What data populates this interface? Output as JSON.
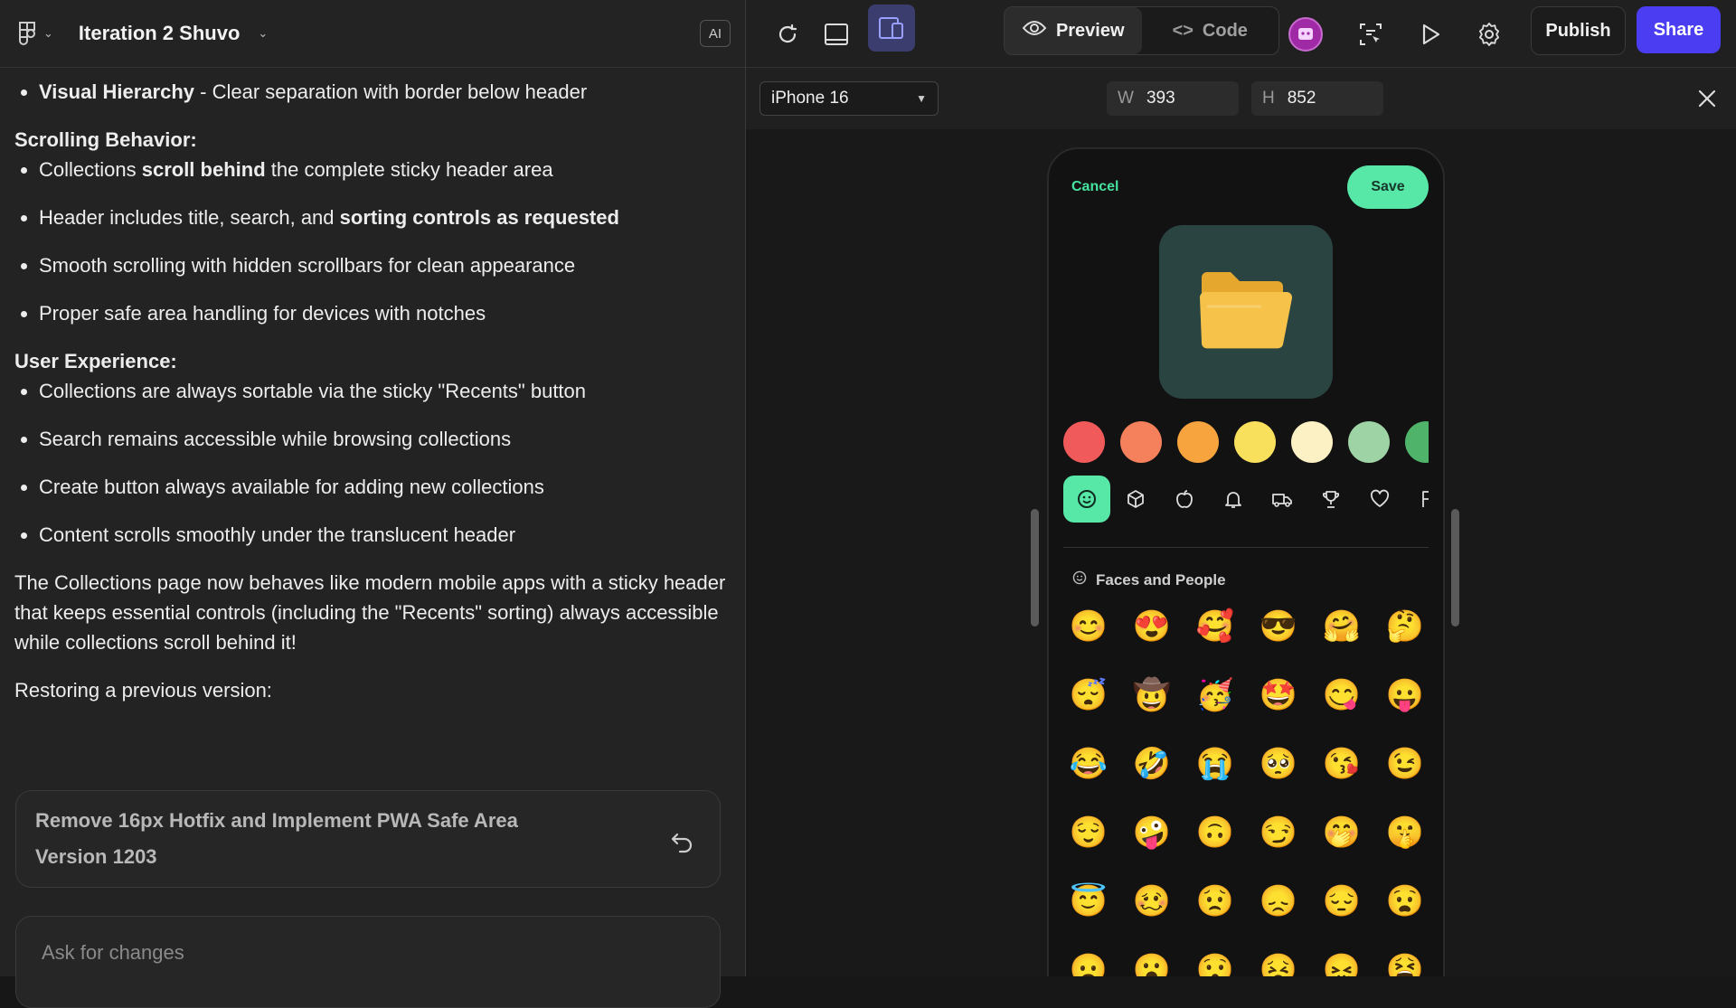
{
  "left": {
    "project_title": "Iteration 2 Shuvo",
    "ai_badge": "AI",
    "b1_title": "Visual Hierarchy",
    "b1_rest": " - Clear separation with border below header",
    "scroll_heading": "Scrolling Behavior:",
    "scroll_b1_pre": "Collections ",
    "scroll_b1_bold": "scroll behind",
    "scroll_b1_post": " the complete sticky header area",
    "scroll_b2_pre": "Header includes title, search, and ",
    "scroll_b2_bold": "sorting controls as requested",
    "scroll_b3": "Smooth scrolling with hidden scrollbars for clean appearance",
    "scroll_b4": "Proper safe area handling for devices with notches",
    "ux_heading": "User Experience:",
    "ux_b1": "Collections are always sortable via the sticky \"Recents\" button",
    "ux_b2": "Search remains accessible while browsing collections",
    "ux_b3": "Create button always available for adding new collections",
    "ux_b4": "Content scrolls smoothly under the translucent header",
    "summary": "The Collections page now behaves like modern mobile apps with a sticky header that keeps essential controls (including the \"Recents\" sorting) always accessible while collections scroll behind it!",
    "restore_label": "Restoring a previous version:",
    "restore_card_title": "Remove 16px Hotfix and Implement PWA Safe Area",
    "restore_card_version": "Version 1203",
    "ask_placeholder": "Ask for changes"
  },
  "toolbar": {
    "preview_label": "Preview",
    "code_label": "Code",
    "publish_label": "Publish",
    "share_label": "Share",
    "share_color": "#4b3df2"
  },
  "subbar": {
    "device": "iPhone 16",
    "w_key": "W",
    "w_value": "393",
    "h_key": "H",
    "h_value": "852"
  },
  "phone": {
    "cancel_label": "Cancel",
    "save_label": "Save",
    "accent": "#57e7a7",
    "icon": "folder-icon",
    "swatch_colors": [
      "#f05a5a",
      "#f5815c",
      "#f7a33e",
      "#f8df5c",
      "#fcf1c4",
      "#9ed3a5",
      "#4fb36a"
    ],
    "category_icons": [
      "smiley-icon",
      "cube-icon",
      "apple-icon",
      "bell-icon",
      "car-icon",
      "trophy-icon",
      "heart-icon",
      "flag-icon"
    ],
    "section_title": "Faces and People",
    "emojis": [
      "😊",
      "😍",
      "🥰",
      "😎",
      "🤗",
      "🤔",
      "😴",
      "🤠",
      "🥳",
      "🤩",
      "😋",
      "😛",
      "😂",
      "🤣",
      "😭",
      "🥺",
      "😘",
      "😉",
      "😌",
      "🤪",
      "🙃",
      "😏",
      "🤭",
      "🤫",
      "😇",
      "🥴",
      "😟",
      "😞",
      "😔",
      "😧",
      "😦",
      "😮",
      "😯",
      "😣",
      "😖",
      "😫"
    ]
  }
}
